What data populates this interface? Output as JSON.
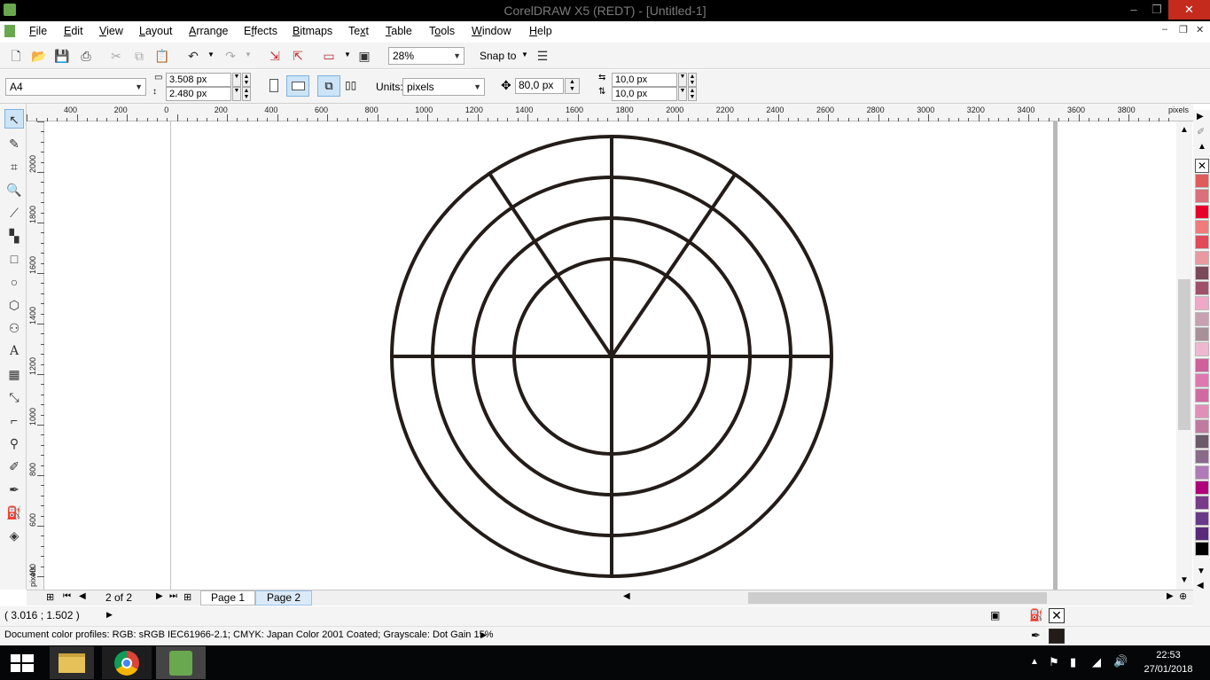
{
  "window": {
    "title": "CorelDRAW X5 (REDT) - [Untitled-1]",
    "minimize": "–",
    "restore": "❐",
    "close": "✕"
  },
  "menu": [
    "File",
    "Edit",
    "View",
    "Layout",
    "Arrange",
    "Effects",
    "Bitmaps",
    "Text",
    "Table",
    "Tools",
    "Window",
    "Help"
  ],
  "menu_mnemonics": [
    "F",
    "E",
    "V",
    "L",
    "A",
    "f",
    "B",
    "x",
    "T",
    "o",
    "W",
    "H"
  ],
  "toolbar": {
    "zoom": "28%",
    "snap_to": "Snap to"
  },
  "property_bar": {
    "paper_size": "A4",
    "width": "3.508 px",
    "height": "2.480 px",
    "units_label": "Units:",
    "units": "pixels",
    "nudge": "80,0 px",
    "dup_x": "10,0 px",
    "dup_y": "10,0 px"
  },
  "ruler": {
    "h_labels": [
      "400",
      "200",
      "0",
      "200",
      "400",
      "600",
      "800",
      "1000",
      "1200",
      "1400",
      "1600",
      "1800",
      "2000",
      "2200",
      "2400",
      "2600",
      "2800",
      "3000",
      "3200",
      "3400",
      "3600",
      "3800"
    ],
    "h_unit": "pixels",
    "v_labels": [
      "2000",
      "1800",
      "1600",
      "1400",
      "1200",
      "1000",
      "800",
      "600",
      "400"
    ],
    "v_unit": "pixels"
  },
  "page_nav": {
    "counter": "2 of 2",
    "tabs": [
      "Page 1",
      "Page 2"
    ],
    "active": 1
  },
  "status": {
    "coords": "( 3.016 ; 1.502 )",
    "color_profiles": "Document color profiles: RGB: sRGB IEC61966-2.1; CMYK: Japan Color 2001 Coated; Grayscale: Dot Gain 15%"
  },
  "palette": [
    "#e05a5a",
    "#d9707a",
    "#e8002a",
    "#f07b7b",
    "#e04a5a",
    "#e89aa0",
    "#7a4a5a",
    "#a0506a",
    "#f0a8c8",
    "#c8a0b0",
    "#a89098",
    "#f0b8d0",
    "#d0609a",
    "#e078b0",
    "#d06aa0",
    "#e090b8",
    "#c07aa0",
    "#6a5a6a",
    "#8a6a8a",
    "#b07ab8",
    "#b0007a",
    "#7a3a8a",
    "#6a3a8a",
    "#5a2a7a",
    "#000000"
  ],
  "taskbar": {
    "time": "22:53",
    "date": "27/01/2018"
  }
}
